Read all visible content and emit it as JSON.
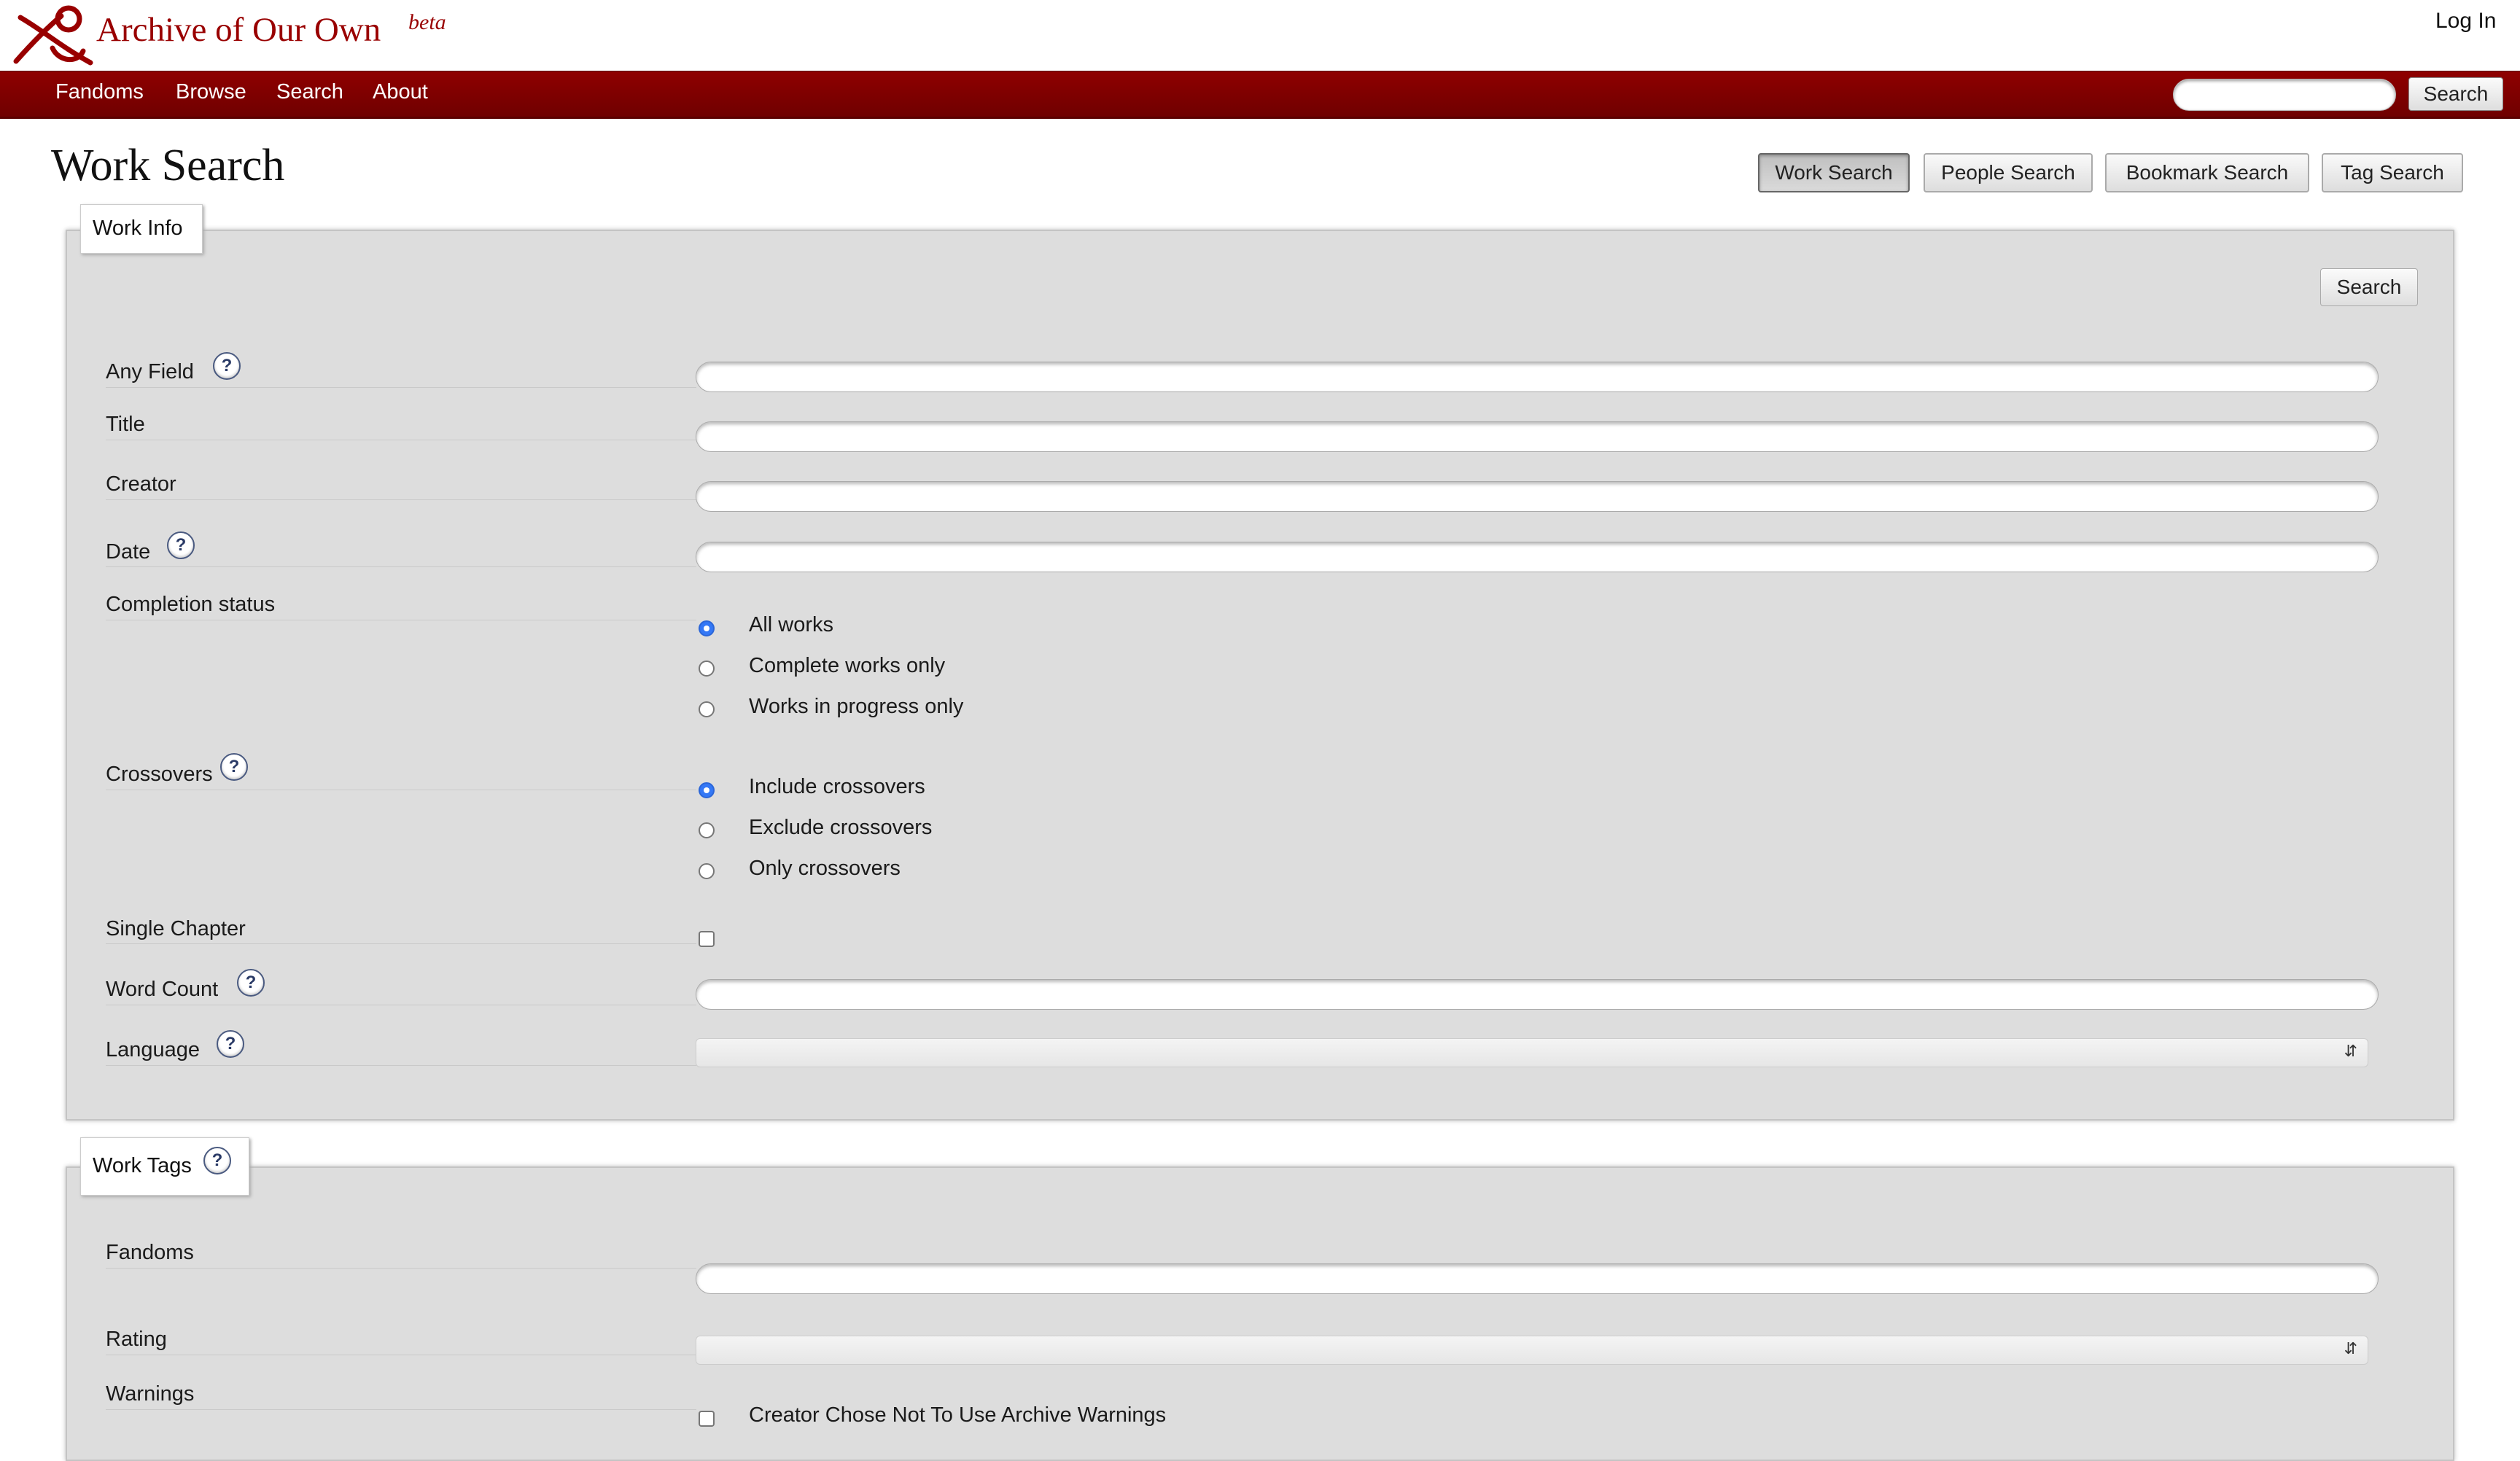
{
  "header": {
    "site_name": "Archive of Our Own",
    "beta_label": "beta",
    "login_label": "Log In"
  },
  "nav": {
    "items": [
      {
        "label": "Fandoms"
      },
      {
        "label": "Browse"
      },
      {
        "label": "Search"
      },
      {
        "label": "About"
      }
    ],
    "search_placeholder": "",
    "search_button": "Search"
  },
  "page": {
    "title": "Work Search",
    "tabs": [
      {
        "label": "Work Search",
        "active": true
      },
      {
        "label": "People Search",
        "active": false
      },
      {
        "label": "Bookmark Search",
        "active": false
      },
      {
        "label": "Tag Search",
        "active": false
      }
    ]
  },
  "work_info": {
    "legend": "Work Info",
    "search_button": "Search",
    "fields": {
      "any_field": {
        "label": "Any Field",
        "value": ""
      },
      "title": {
        "label": "Title",
        "value": ""
      },
      "creator": {
        "label": "Creator",
        "value": ""
      },
      "date": {
        "label": "Date",
        "value": ""
      },
      "completion": {
        "label": "Completion status",
        "options": [
          {
            "label": "All works",
            "checked": true
          },
          {
            "label": "Complete works only",
            "checked": false
          },
          {
            "label": "Works in progress only",
            "checked": false
          }
        ]
      },
      "crossovers": {
        "label": "Crossovers",
        "options": [
          {
            "label": "Include crossovers",
            "checked": true
          },
          {
            "label": "Exclude crossovers",
            "checked": false
          },
          {
            "label": "Only crossovers",
            "checked": false
          }
        ]
      },
      "single_chapter": {
        "label": "Single Chapter",
        "checked": false
      },
      "word_count": {
        "label": "Word Count",
        "value": ""
      },
      "language": {
        "label": "Language",
        "value": ""
      }
    },
    "help_glyph": "?"
  },
  "work_tags": {
    "legend": "Work Tags",
    "fields": {
      "fandoms": {
        "label": "Fandoms",
        "value": ""
      },
      "rating": {
        "label": "Rating",
        "value": ""
      },
      "warnings": {
        "label": "Warnings",
        "options": [
          {
            "label": "Creator Chose Not To Use Archive Warnings",
            "checked": false
          }
        ]
      }
    }
  },
  "icons": {
    "logo": "ao3-logo-icon",
    "help": "help-question-icon",
    "select": "chevron-updown-icon"
  },
  "colors": {
    "brand": "#990000",
    "nav_bg": "#7f0000",
    "panel_bg": "#dddddd",
    "radio_checked": "#3478f6"
  }
}
